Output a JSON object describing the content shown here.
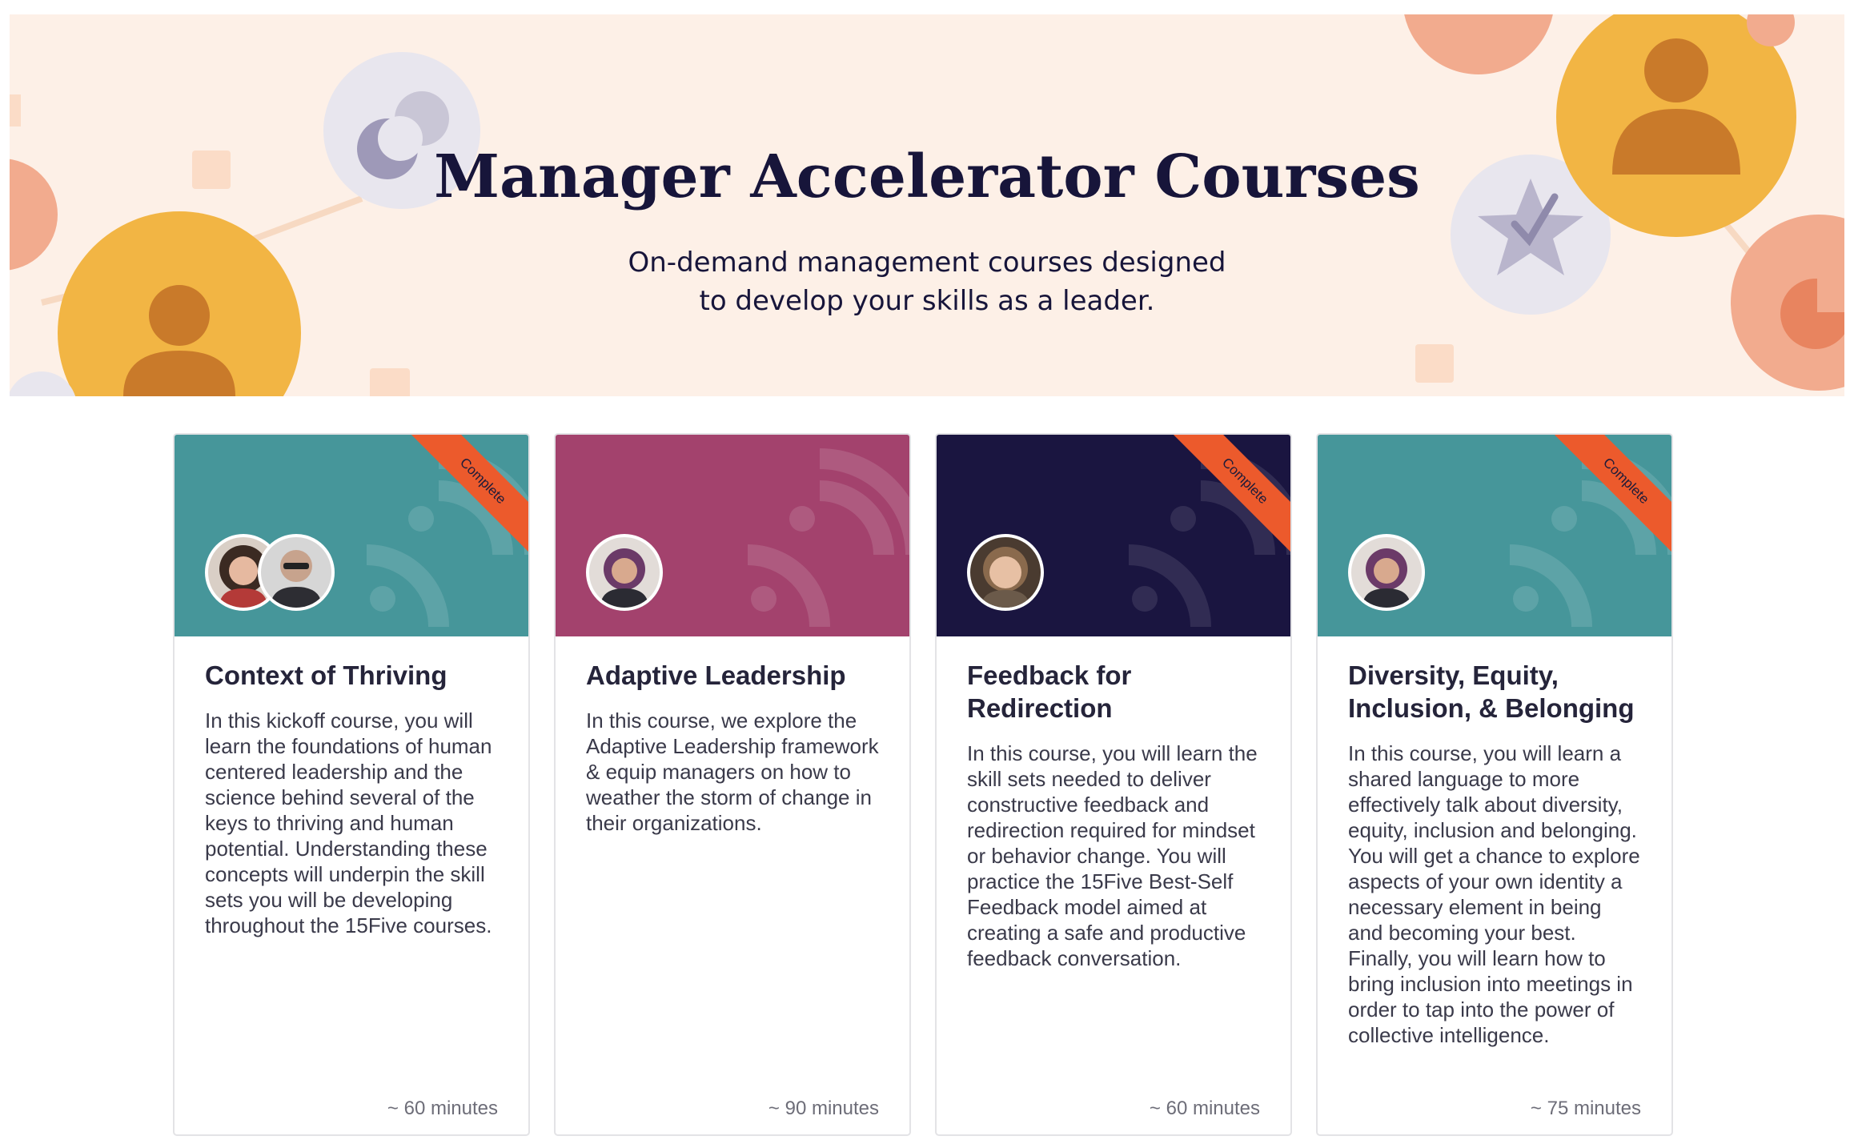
{
  "hero": {
    "title": "Manager Accelerator Courses",
    "subtitle_line1": "On-demand management courses designed",
    "subtitle_line2": "to develop your skills as a leader."
  },
  "colors": {
    "hero_bg": "#fdf0e7",
    "teal": "#46969a",
    "magenta": "#a3426d",
    "navy": "#1a1540",
    "ribbon": "#ec5a2c",
    "title_ink": "#17153a"
  },
  "courses": [
    {
      "title": "Context of Thriving",
      "description": "In this kickoff course, you will learn the foundations of human centered leadership and the science behind several of the keys to thriving and human potential. Understanding these concepts will underpin the skill sets you will be developing throughout the 15Five courses.",
      "duration": "~ 60 minutes",
      "badge": "Complete",
      "header_color": "#46969a",
      "avatars": 2
    },
    {
      "title": "Adaptive Leadership",
      "description": "In this course, we explore the Adaptive Leadership framework & equip managers on how to weather the storm of change in their organizations.",
      "duration": "~ 90 minutes",
      "badge": "",
      "header_color": "#a3426d",
      "avatars": 1
    },
    {
      "title": "Feedback for Redirection",
      "description": "In this course, you will learn the skill sets needed to deliver constructive feedback and redirection required for mindset or behavior change. You will practice the 15Five Best-Self Feedback model aimed at creating a safe and productive feedback conversation.",
      "duration": "~ 60 minutes",
      "badge": "Complete",
      "header_color": "#1a1540",
      "avatars": 1
    },
    {
      "title": "Diversity, Equity, Inclusion, & Belonging",
      "description": "In this course, you will learn a shared language to more effectively talk about diversity, equity, inclusion and belonging. You will get a chance to explore aspects of your own identity a necessary element in being and becoming your best. Finally, you will learn how to bring inclusion into meetings in order to tap into the power of collective intelligence.",
      "duration": "~ 75 minutes",
      "badge": "Complete",
      "header_color": "#46969a",
      "avatars": 1
    }
  ]
}
